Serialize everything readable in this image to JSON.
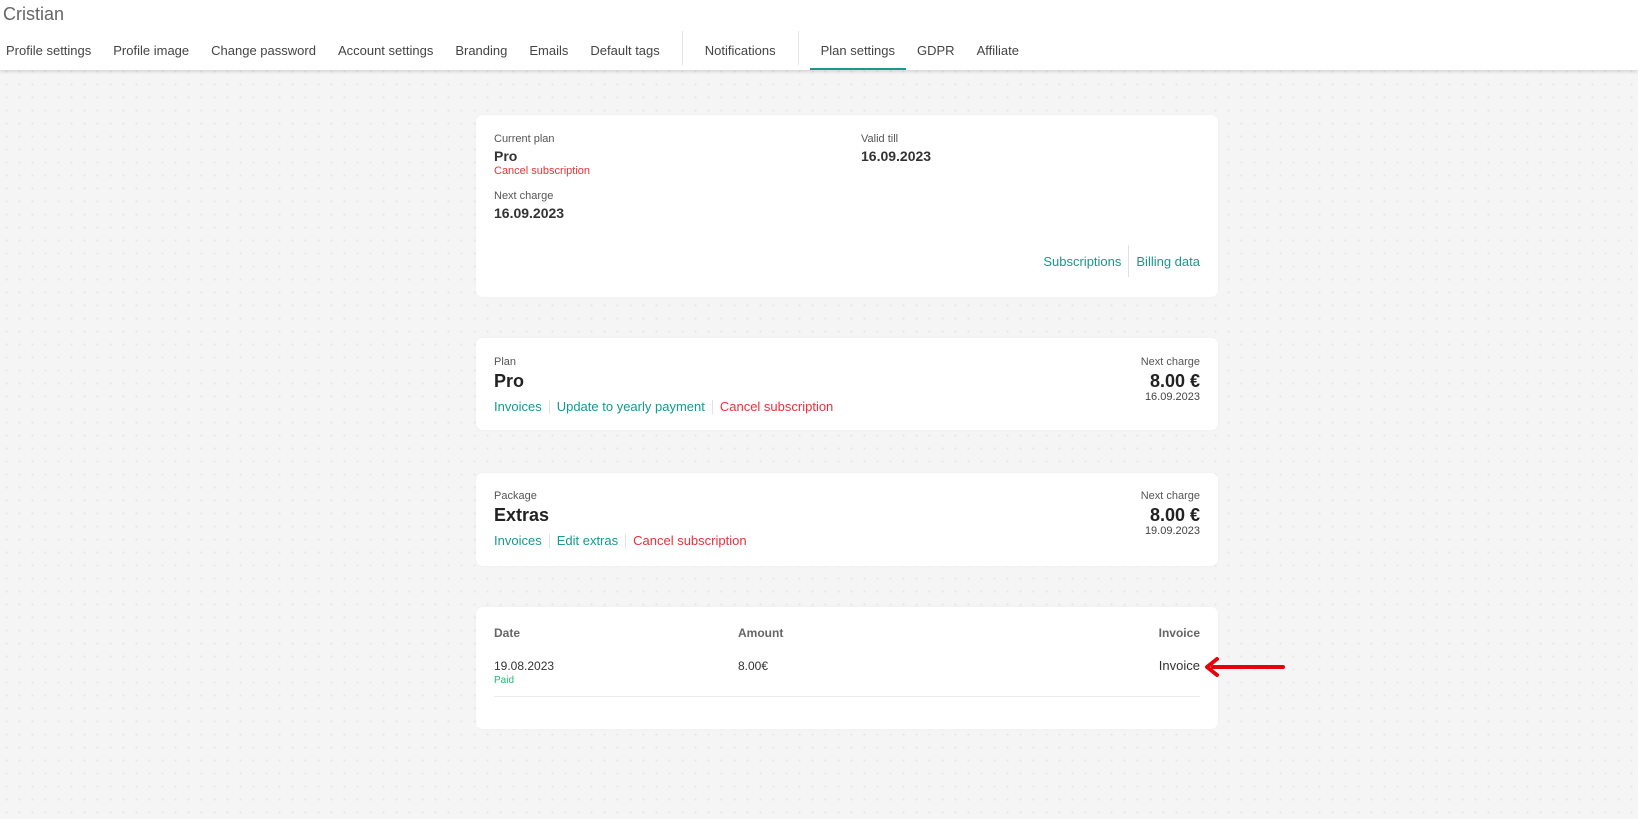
{
  "header": {
    "user_name": "Cristian",
    "tabs": [
      {
        "label": "Profile settings",
        "active": false
      },
      {
        "label": "Profile image",
        "active": false
      },
      {
        "label": "Change password",
        "active": false
      },
      {
        "label": "Account settings",
        "active": false
      },
      {
        "label": "Branding",
        "active": false
      },
      {
        "label": "Emails",
        "active": false
      },
      {
        "label": "Default tags",
        "active": false
      },
      {
        "label": "Notifications",
        "active": false
      },
      {
        "label": "Plan settings",
        "active": true
      },
      {
        "label": "GDPR",
        "active": false
      },
      {
        "label": "Affiliate",
        "active": false
      }
    ],
    "accent_color": "#159a8c"
  },
  "summary": {
    "current_plan_label": "Current plan",
    "current_plan_value": "Pro",
    "cancel_label": "Cancel subscription",
    "valid_till_label": "Valid till",
    "valid_till_value": "16.09.2023",
    "next_charge_label": "Next charge",
    "next_charge_value": "16.09.2023",
    "subscriptions_link": "Subscriptions",
    "billing_data_link": "Billing data"
  },
  "plan": {
    "label": "Plan",
    "name": "Pro",
    "invoices_link": "Invoices",
    "update_link": "Update to yearly payment",
    "cancel_link": "Cancel subscription",
    "next_charge_label": "Next charge",
    "next_charge_amount": "8.00 €",
    "next_charge_date": "16.09.2023"
  },
  "package": {
    "label": "Package",
    "name": "Extras",
    "invoices_link": "Invoices",
    "edit_link": "Edit extras",
    "cancel_link": "Cancel subscription",
    "next_charge_label": "Next charge",
    "next_charge_amount": "8.00 €",
    "next_charge_date": "19.09.2023"
  },
  "invoices_table": {
    "headers": {
      "date": "Date",
      "amount": "Amount",
      "invoice": "Invoice"
    },
    "rows": [
      {
        "date": "19.08.2023",
        "status": "Paid",
        "amount": "8.00€",
        "invoice_link": "Invoice"
      }
    ]
  },
  "annotation": {
    "arrow_color": "#e8000b",
    "points_to": "invoice-link"
  }
}
